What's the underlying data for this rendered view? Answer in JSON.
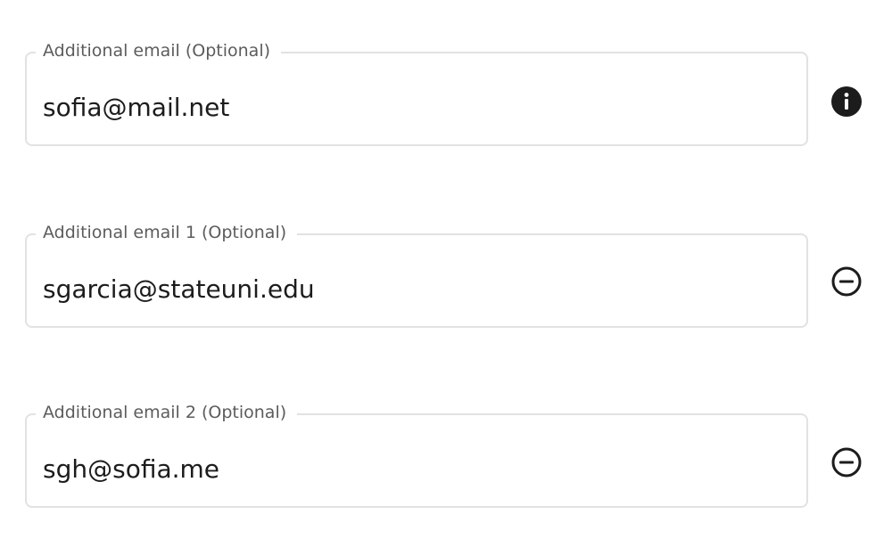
{
  "fields": [
    {
      "label": "Additional email (Optional)",
      "value": "sofia@mail.net",
      "action_icon": "info-icon"
    },
    {
      "label": "Additional email 1 (Optional)",
      "value": "sgarcia@stateuni.edu",
      "action_icon": "remove-circle-icon"
    },
    {
      "label": "Additional email 2 (Optional)",
      "value": "sgh@sofia.me",
      "action_icon": "remove-circle-icon"
    }
  ],
  "colors": {
    "border": "#e2e2e2",
    "label": "#5c5c5c",
    "text": "#1c1c1c",
    "icon": "#1c1c1c"
  }
}
